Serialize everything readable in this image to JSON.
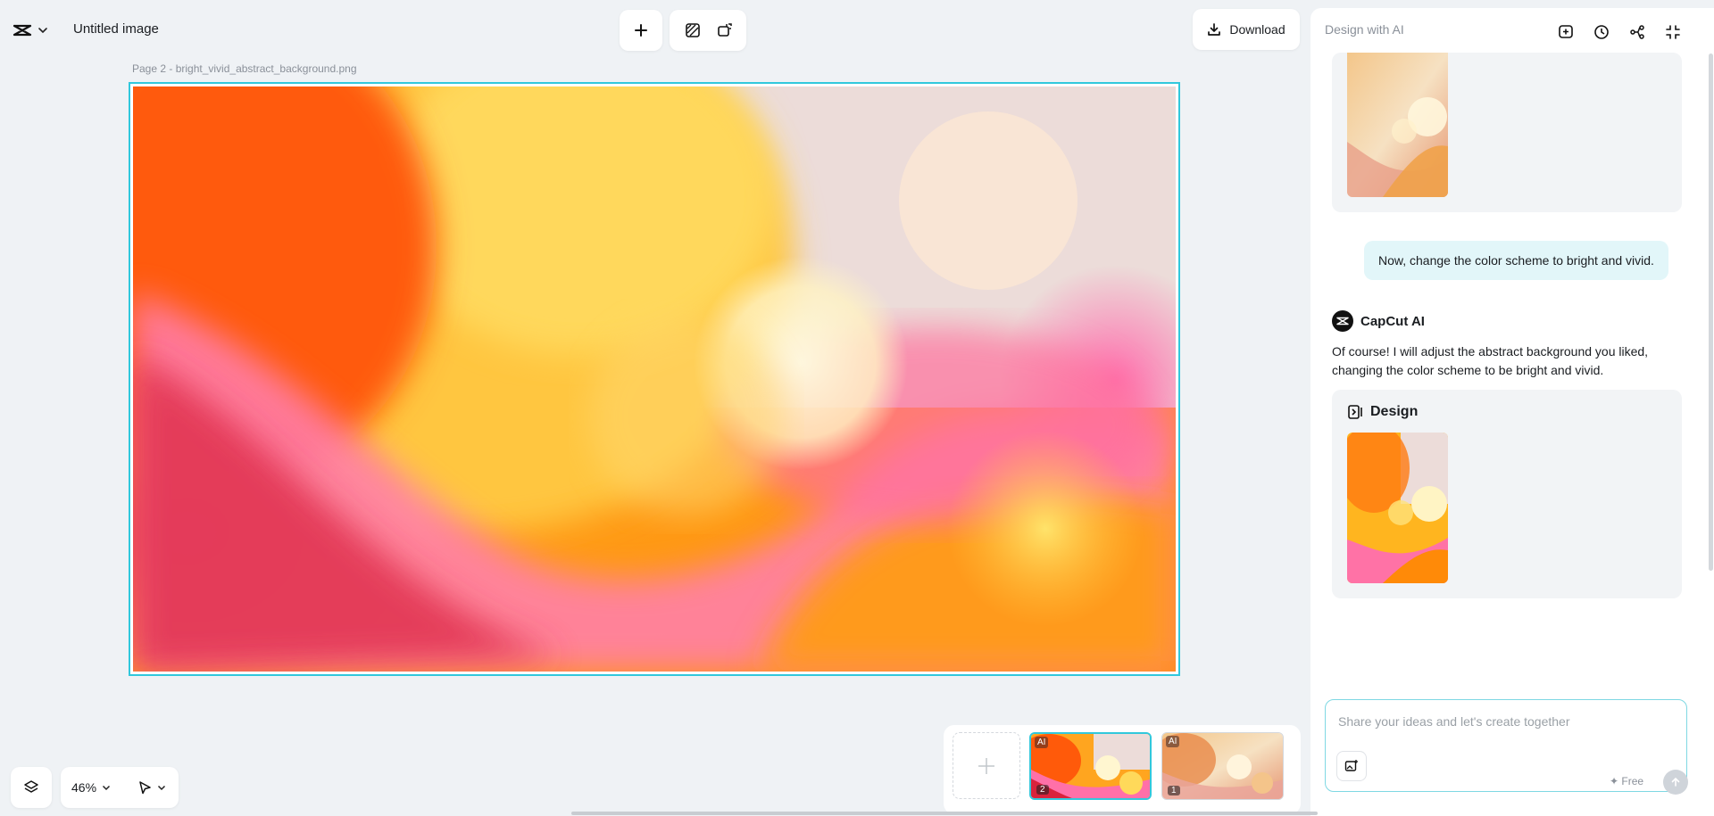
{
  "header": {
    "doc_title": "Untitled image",
    "download_label": "Download"
  },
  "canvas": {
    "page_label": "Page 2 -  bright_vivid_abstract_background.png"
  },
  "panel": {
    "title": "Design with AI",
    "user_message": "Now, change the color scheme to bright and vivid.",
    "ai_name": "CapCut AI",
    "ai_message": "Of course! I will adjust the abstract background you liked, changing the color scheme to be bright and vivid.",
    "design_heading": "Design",
    "input_placeholder": "Share your ideas and let's create together",
    "free_label": "✦ Free"
  },
  "pages": {
    "items": [
      {
        "badge": "AI",
        "number": "2",
        "selected": true
      },
      {
        "badge": "AI",
        "number": "1",
        "selected": false
      }
    ]
  },
  "bottom": {
    "zoom": "46%"
  },
  "colors": {
    "accent": "#31c8dc",
    "bubble": "#e2f6f9",
    "background": "#eff2f5"
  }
}
